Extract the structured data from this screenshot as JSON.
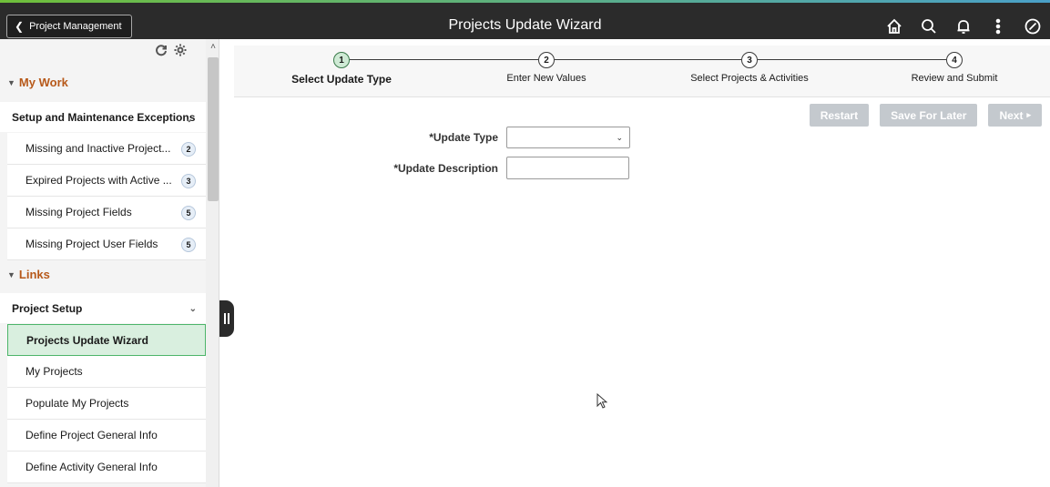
{
  "header": {
    "back_label": "Project Management",
    "title": "Projects Update Wizard",
    "icons": [
      "home-icon",
      "search-icon",
      "bell-icon",
      "more-vertical-icon",
      "compass-icon"
    ]
  },
  "sidebar": {
    "tools": [
      "refresh-icon",
      "gear-icon"
    ],
    "my_work": {
      "title": "My Work",
      "group": "Setup and Maintenance Exceptions",
      "items": [
        {
          "label": "Missing and Inactive Project...",
          "count": "2"
        },
        {
          "label": "Expired Projects with Active ...",
          "count": "3"
        },
        {
          "label": "Missing Project Fields",
          "count": "5"
        },
        {
          "label": "Missing Project User Fields",
          "count": "5"
        }
      ]
    },
    "links": {
      "title": "Links",
      "group": "Project Setup",
      "items": [
        {
          "label": "Projects Update Wizard",
          "active": true
        },
        {
          "label": "My Projects"
        },
        {
          "label": "Populate My Projects"
        },
        {
          "label": "Define Project General Info"
        },
        {
          "label": "Define Activity General Info"
        }
      ]
    }
  },
  "steps": [
    {
      "number": "1",
      "label": "Select Update Type",
      "current": true
    },
    {
      "number": "2",
      "label": "Enter New Values"
    },
    {
      "number": "3",
      "label": "Select Projects & Activities"
    },
    {
      "number": "4",
      "label": "Review and Submit"
    }
  ],
  "actions": {
    "restart": "Restart",
    "save_for_later": "Save For Later",
    "next": "Next"
  },
  "form": {
    "update_type_label": "*Update Type",
    "update_type_value": "",
    "update_description_label": "*Update Description",
    "update_description_value": ""
  },
  "colors": {
    "header_bg": "#2b2b2b",
    "section_title": "#b7591a",
    "active_item_bg": "#d9efdf",
    "active_item_border": "#4db56a",
    "disabled_button": "#c4c9ce"
  }
}
